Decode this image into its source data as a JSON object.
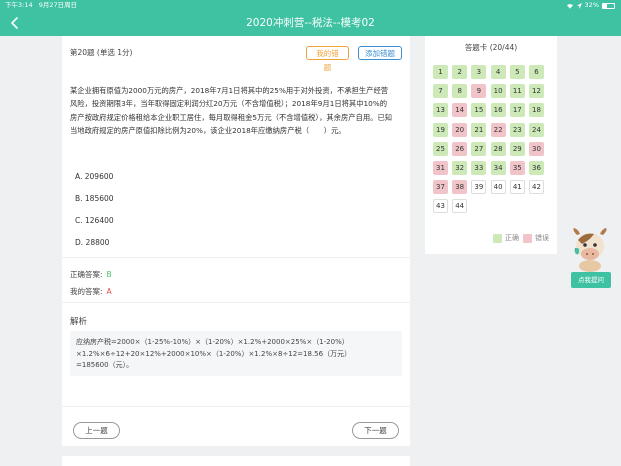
{
  "status": {
    "time": "下午3:14",
    "date": "9月27日周日",
    "battery": "32%",
    "battery_fraction": 0.32
  },
  "nav": {
    "title": "2020冲刺营--税法--模考02"
  },
  "question": {
    "header": "第20题 (单选 1分)",
    "my_wrong_label": "我的错题",
    "add_wrong_label": "添加错题",
    "stem": "某企业拥有原值为2000万元的房产，2018年7月1日将其中的25%用于对外投资，不承担生产经营风险，投资期限3年，当年取得固定利润分红20万元（不含增值税）；2018年9月1日将其中10%的房产按政府规定价格租给本企业职工居住，每月取得租金5万元（不含增值税），其余房产自用。已知当地政府规定的房产原值扣除比例为20%，该企业2018年应缴纳房产税（　　）元。",
    "options": [
      {
        "label": "A. 209600"
      },
      {
        "label": "B. 185600"
      },
      {
        "label": "C. 126400"
      },
      {
        "label": "D. 28800"
      }
    ],
    "correct_label": "正确答案:",
    "correct_value": "B",
    "my_label": "我的答案:",
    "my_value": "A",
    "analysis_title": "解析",
    "analysis_lines": [
      "应纳房产税=2000×（1-25%-10%）×（1-20%）×1.2%+2000×25%×（1-20%）",
      "×1.2%×6÷12+20×12%+2000×10%×（1-20%）×1.2%×8÷12=18.56（万元）",
      "=185600（元）。"
    ],
    "prev_label": "上一题",
    "next_label": "下一题"
  },
  "answer_sheet": {
    "title": "答题卡 (20/44)",
    "items": [
      {
        "n": "1",
        "s": "correct"
      },
      {
        "n": "2",
        "s": "correct"
      },
      {
        "n": "3",
        "s": "correct"
      },
      {
        "n": "4",
        "s": "correct"
      },
      {
        "n": "5",
        "s": "correct"
      },
      {
        "n": "6",
        "s": "correct"
      },
      {
        "n": "7",
        "s": "correct"
      },
      {
        "n": "8",
        "s": "correct"
      },
      {
        "n": "9",
        "s": "wrong"
      },
      {
        "n": "10",
        "s": "correct"
      },
      {
        "n": "11",
        "s": "correct"
      },
      {
        "n": "12",
        "s": "correct"
      },
      {
        "n": "13",
        "s": "correct"
      },
      {
        "n": "14",
        "s": "wrong"
      },
      {
        "n": "15",
        "s": "correct"
      },
      {
        "n": "16",
        "s": "correct"
      },
      {
        "n": "17",
        "s": "correct"
      },
      {
        "n": "18",
        "s": "correct"
      },
      {
        "n": "19",
        "s": "correct"
      },
      {
        "n": "20",
        "s": "wrong"
      },
      {
        "n": "21",
        "s": "correct"
      },
      {
        "n": "22",
        "s": "wrong"
      },
      {
        "n": "23",
        "s": "correct"
      },
      {
        "n": "24",
        "s": "correct"
      },
      {
        "n": "25",
        "s": "correct"
      },
      {
        "n": "26",
        "s": "wrong"
      },
      {
        "n": "27",
        "s": "correct"
      },
      {
        "n": "28",
        "s": "correct"
      },
      {
        "n": "29",
        "s": "correct"
      },
      {
        "n": "30",
        "s": "wrong"
      },
      {
        "n": "31",
        "s": "wrong"
      },
      {
        "n": "32",
        "s": "correct"
      },
      {
        "n": "33",
        "s": "correct"
      },
      {
        "n": "34",
        "s": "correct"
      },
      {
        "n": "35",
        "s": "wrong"
      },
      {
        "n": "36",
        "s": "correct"
      },
      {
        "n": "37",
        "s": "wrong"
      },
      {
        "n": "38",
        "s": "wrong"
      },
      {
        "n": "39",
        "s": "unanswered"
      },
      {
        "n": "40",
        "s": "unanswered"
      },
      {
        "n": "41",
        "s": "unanswered"
      },
      {
        "n": "42",
        "s": "unanswered"
      },
      {
        "n": "43",
        "s": "unanswered"
      },
      {
        "n": "44",
        "s": "unanswered"
      }
    ],
    "legend_correct": "正确",
    "legend_wrong": "错误"
  },
  "assistant": {
    "ask_label": "点我提问",
    "mascot_icon": "cow-mascot-icon"
  },
  "colors": {
    "primary": "#3ec2a2",
    "correct_bg": "#cde9b8",
    "wrong_bg": "#f0c4c8",
    "orange": "#f0a23a",
    "blue": "#3b8fd6"
  }
}
